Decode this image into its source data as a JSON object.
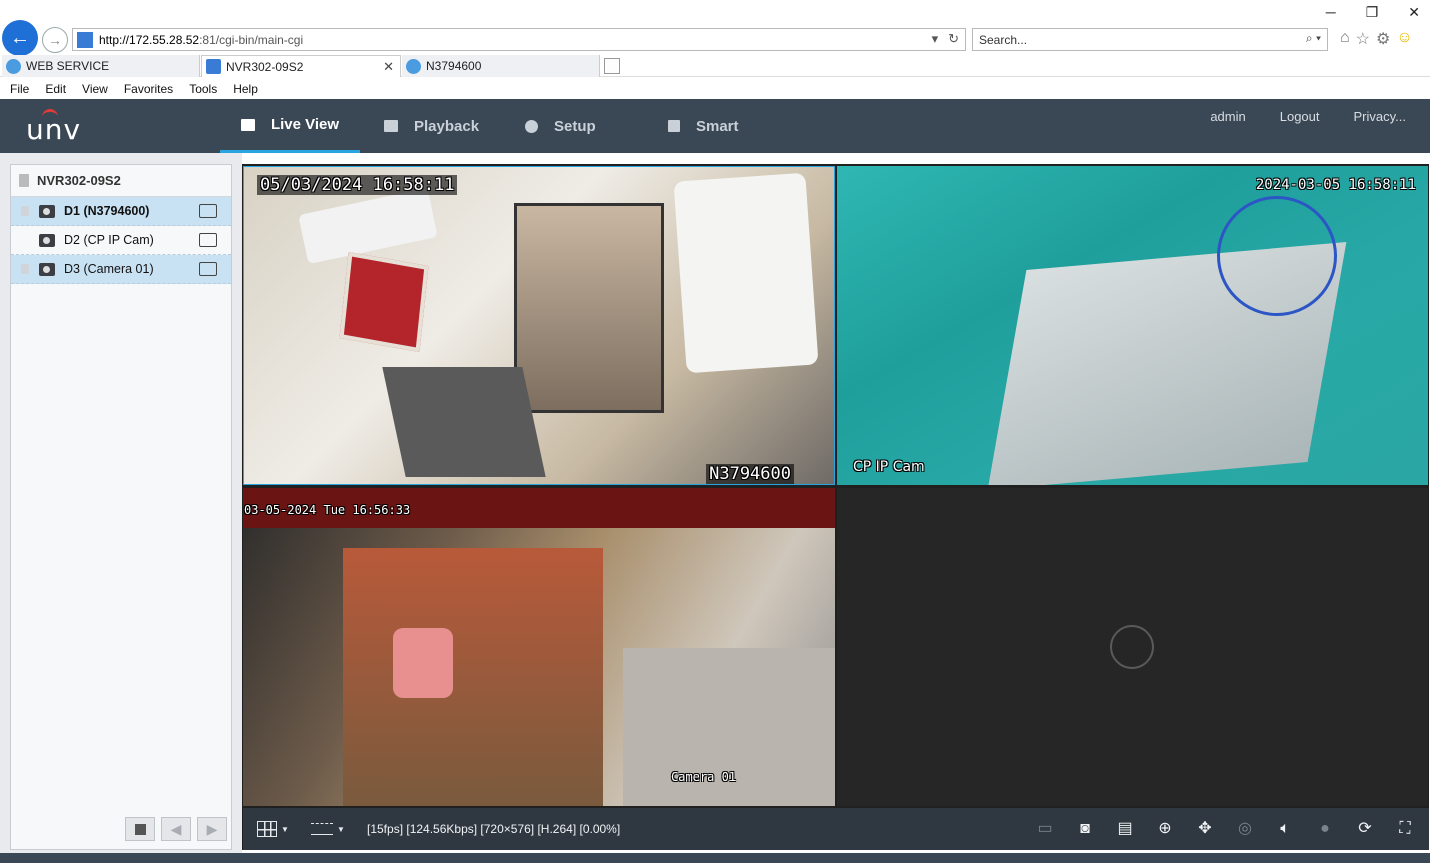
{
  "browser": {
    "url_host": "http://172.55.28.52",
    "url_rest": ":81/cgi-bin/main-cgi",
    "search_placeholder": "Search...",
    "tabs": [
      {
        "label": "WEB SERVICE"
      },
      {
        "label": "NVR302-09S2"
      },
      {
        "label": "N3794600"
      }
    ],
    "menu": [
      "File",
      "Edit",
      "View",
      "Favorites",
      "Tools",
      "Help"
    ],
    "window_controls": [
      "─",
      "❐",
      "✕"
    ]
  },
  "app": {
    "logo": "UNV",
    "nav": [
      {
        "label": "Live View"
      },
      {
        "label": "Playback"
      },
      {
        "label": "Setup"
      },
      {
        "label": "Smart"
      }
    ],
    "user": {
      "name": "admin",
      "logout": "Logout",
      "privacy": "Privacy..."
    }
  },
  "device_tree": {
    "device_name": "NVR302-09S2",
    "channels": [
      {
        "label": "D1 (N3794600)"
      },
      {
        "label": "D2 (CP IP Cam)"
      },
      {
        "label": "D3 (Camera 01)"
      }
    ]
  },
  "video": {
    "tiles": [
      {
        "timestamp": "05/03/2024 16:58:11",
        "name": "N3794600"
      },
      {
        "timestamp": "2024-03-05 16:58:11",
        "name": "CP IP Cam"
      },
      {
        "timestamp": "03-05-2024 Tue 16:56:33",
        "name": "Camera 01"
      },
      {
        "timestamp": "",
        "name": ""
      }
    ]
  },
  "toolbar": {
    "status": "[15fps] [124.56Kbps] [720×576] [H.264] [0.00%]",
    "icons": [
      "snapshot-icon",
      "record-icon",
      "zoom-icon",
      "ptz-icon",
      "fisheye-icon",
      "audio-icon",
      "talk-icon",
      "3d-zoom-icon",
      "fullscreen-icon"
    ]
  },
  "colors": {
    "header_bg": "#3a4755",
    "accent": "#2aa4e0",
    "selected_row": "#c9e2f3",
    "toolbar_bg": "#2f3740"
  }
}
